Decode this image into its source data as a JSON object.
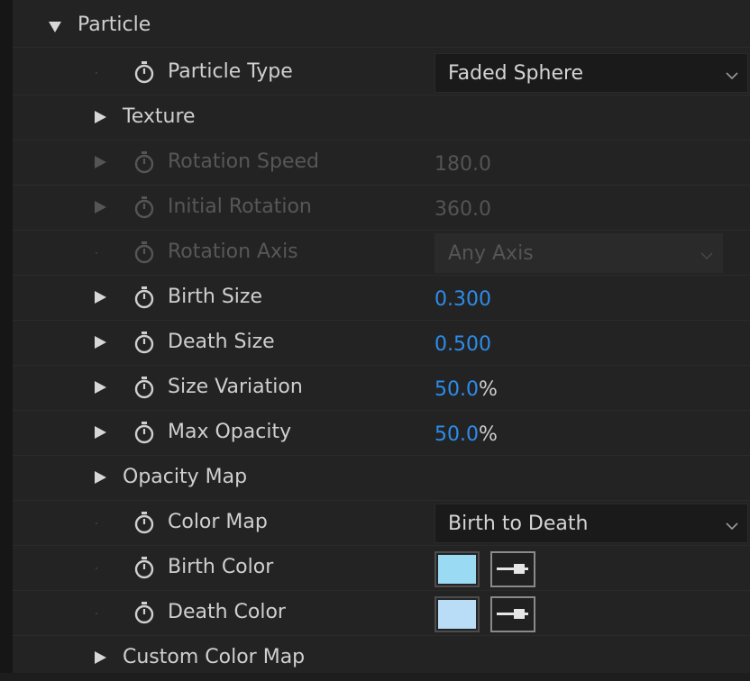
{
  "section": {
    "label": "Particle"
  },
  "rows": [
    {
      "label": "Particle Type",
      "control": "dropdown",
      "value": "Faded Sphere"
    },
    {
      "label": "Texture",
      "control": "group"
    },
    {
      "label": "Rotation Speed",
      "control": "number",
      "value": "180.0",
      "disabled": true
    },
    {
      "label": "Initial Rotation",
      "control": "number",
      "value": "360.0",
      "disabled": true
    },
    {
      "label": "Rotation Axis",
      "control": "dropdown",
      "value": "Any Axis",
      "disabled": true
    },
    {
      "label": "Birth Size",
      "control": "number",
      "value": "0.300"
    },
    {
      "label": "Death Size",
      "control": "number",
      "value": "0.500"
    },
    {
      "label": "Size Variation",
      "control": "number",
      "value": "50.0",
      "unit": "%"
    },
    {
      "label": "Max Opacity",
      "control": "number",
      "value": "50.0",
      "unit": "%"
    },
    {
      "label": "Opacity Map",
      "control": "group"
    },
    {
      "label": "Color Map",
      "control": "dropdown",
      "value": "Birth to Death"
    },
    {
      "label": "Birth Color",
      "control": "color",
      "color": "#9bdaf3"
    },
    {
      "label": "Death Color",
      "control": "color",
      "color": "#b9dcf7"
    },
    {
      "label": "Custom Color Map",
      "control": "group"
    }
  ],
  "icons": {
    "expand_open": "triangle-down-icon",
    "expand_closed": "triangle-right-icon",
    "keyframe": "stopwatch-icon",
    "dropdown": "chevron-down-icon",
    "eyedropper": "eyedropper-icon"
  },
  "colors": {
    "value_blue": "#2d8ceb",
    "panel_bg": "#232323",
    "birth_color": "#9bdaf3",
    "death_color": "#b9dcf7"
  }
}
